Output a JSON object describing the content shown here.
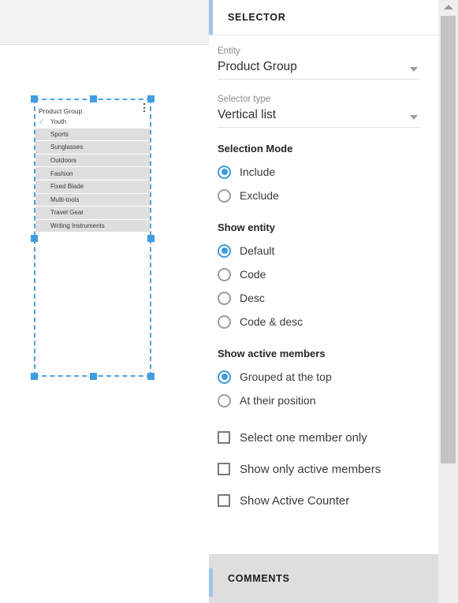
{
  "canvas": {
    "widget": {
      "title": "Product Group",
      "menu_icon": "vertical-dots-icon",
      "check_glyph": "✓",
      "items": [
        {
          "label": "Youth",
          "active": true
        },
        {
          "label": "Sports",
          "active": false
        },
        {
          "label": "Sunglasses",
          "active": false
        },
        {
          "label": "Outdoors",
          "active": false
        },
        {
          "label": "Fashion",
          "active": false
        },
        {
          "label": "Fixed Blade",
          "active": false
        },
        {
          "label": "Multi-tools",
          "active": false
        },
        {
          "label": "Travel Gear",
          "active": false
        },
        {
          "label": "Writing Instruments",
          "active": false
        }
      ]
    }
  },
  "panel": {
    "selector": {
      "title": "SELECTOR",
      "entity": {
        "label": "Entity",
        "value": "Product Group",
        "caret_icon": "chevron-down-icon"
      },
      "selector_type": {
        "label": "Selector type",
        "value": "Vertical list",
        "caret_icon": "chevron-down-icon"
      },
      "selection_mode": {
        "title": "Selection Mode",
        "options": [
          {
            "label": "Include",
            "selected": true
          },
          {
            "label": "Exclude",
            "selected": false
          }
        ]
      },
      "show_entity": {
        "title": "Show entity",
        "options": [
          {
            "label": "Default",
            "selected": true
          },
          {
            "label": "Code",
            "selected": false
          },
          {
            "label": "Desc",
            "selected": false
          },
          {
            "label": "Code & desc",
            "selected": false
          }
        ]
      },
      "show_active_members": {
        "title": "Show active members",
        "options": [
          {
            "label": "Grouped at the top",
            "selected": true
          },
          {
            "label": "At their position",
            "selected": false
          }
        ]
      },
      "checkboxes": [
        {
          "label": "Select one member only",
          "checked": false
        },
        {
          "label": "Show only active members",
          "checked": false
        },
        {
          "label": "Show Active Counter",
          "checked": false
        }
      ]
    },
    "comments": {
      "title": "COMMENTS"
    },
    "scrollbar": {
      "up_arrow_icon": "arrow-up-icon"
    }
  },
  "colors": {
    "accent_blue": "#3f9ad8",
    "header_accent": "#9fc5e8",
    "selection_handle": "#3f9de0",
    "list_row_bg": "#dedede",
    "comments_bg": "#dedede"
  }
}
